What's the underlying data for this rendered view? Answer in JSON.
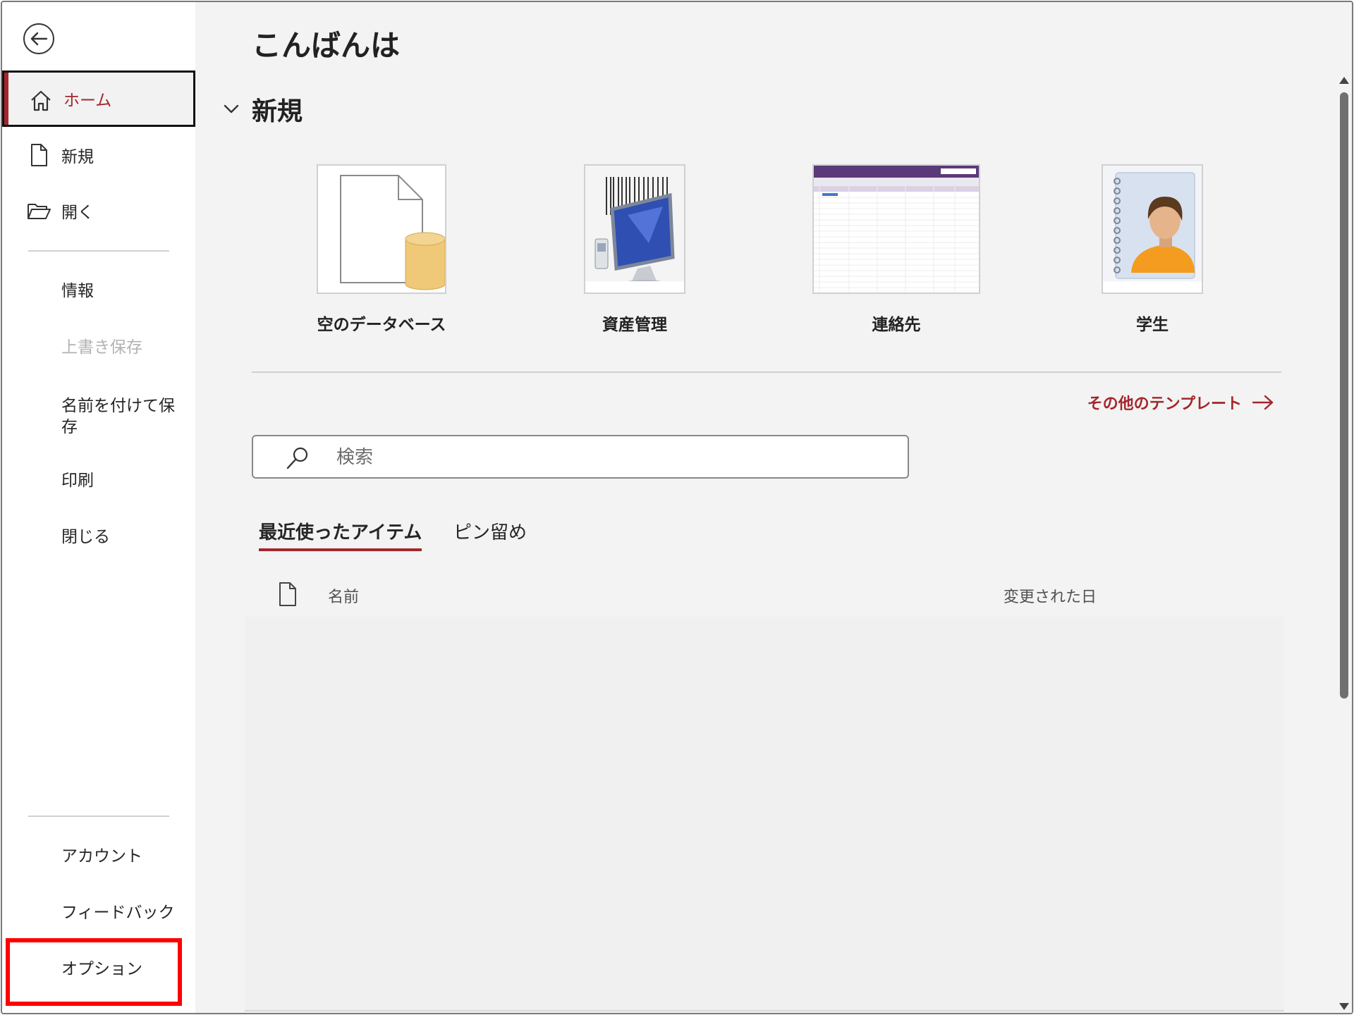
{
  "sidebar": {
    "back_icon": "arrow-left-circle-icon",
    "items": [
      {
        "label": "ホーム",
        "icon": "home-icon"
      },
      {
        "label": "新規",
        "icon": "new-document-icon"
      },
      {
        "label": "開く",
        "icon": "open-folder-icon"
      },
      {
        "label": "情報"
      },
      {
        "label": "上書き保存"
      },
      {
        "label": "名前を付けて保存"
      },
      {
        "label": "印刷"
      },
      {
        "label": "閉じる"
      },
      {
        "label": "アカウント"
      },
      {
        "label": "フィードバック"
      },
      {
        "label": "オプション"
      }
    ]
  },
  "main": {
    "greeting": "こんばんは",
    "new_section_title": "新規",
    "templates": [
      {
        "name": "空のデータベース"
      },
      {
        "name": "資産管理"
      },
      {
        "name": "連絡先"
      },
      {
        "name": "学生"
      }
    ],
    "more_templates_label": "その他のテンプレート",
    "search_placeholder": "検索",
    "tabs": [
      {
        "label": "最近使ったアイテム"
      },
      {
        "label": "ピン留め"
      }
    ],
    "columns": {
      "name": "名前",
      "modified": "変更された日"
    }
  },
  "colors": {
    "accent": "#a4262c",
    "highlight": "#ff0000"
  }
}
